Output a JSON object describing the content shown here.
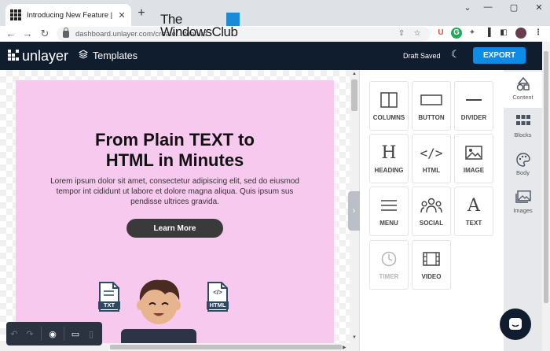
{
  "browser": {
    "tab_title": "Introducing New Feature | Email",
    "url": "dashboard.unlayer.com/create/...feature",
    "window_controls": [
      "minimize-icon",
      "maximize-icon",
      "close-icon"
    ],
    "watermark_line1": "The",
    "watermark_line2": "WindowsClub"
  },
  "app": {
    "brand": "unlayer",
    "templates_label": "Templates",
    "status": "Draft Saved",
    "export_label": "EXPORT",
    "accent_color": "#0e8be7"
  },
  "email": {
    "headline_line1": "From Plain TEXT to",
    "headline_line2": "HTML in Minutes",
    "body": "Lorem ipsum dolor sit amet, consectetur adipiscing elit, sed do eiusmod tempor int cididunt ut labore et dolore magna aliqua. Quis ipsum sus pendisse ultrices gravida.",
    "cta_label": "Learn More",
    "txt_badge": "TXT",
    "html_badge": "HTML",
    "background_color": "#f8c9ee"
  },
  "tools": [
    {
      "label": "COLUMNS",
      "icon": "columns-icon"
    },
    {
      "label": "BUTTON",
      "icon": "button-icon"
    },
    {
      "label": "DIVIDER",
      "icon": "divider-icon"
    },
    {
      "label": "HEADING",
      "icon": "heading-icon"
    },
    {
      "label": "HTML",
      "icon": "code-icon"
    },
    {
      "label": "IMAGE",
      "icon": "image-icon"
    },
    {
      "label": "MENU",
      "icon": "menu-icon"
    },
    {
      "label": "SOCIAL",
      "icon": "social-icon"
    },
    {
      "label": "TEXT",
      "icon": "text-icon"
    },
    {
      "label": "TIMER",
      "icon": "timer-icon"
    },
    {
      "label": "VIDEO",
      "icon": "video-icon"
    }
  ],
  "rail": [
    {
      "label": "Content",
      "icon": "shapes-icon"
    },
    {
      "label": "Blocks",
      "icon": "grid-icon"
    },
    {
      "label": "Body",
      "icon": "palette-icon"
    },
    {
      "label": "Images",
      "icon": "images-icon"
    }
  ]
}
